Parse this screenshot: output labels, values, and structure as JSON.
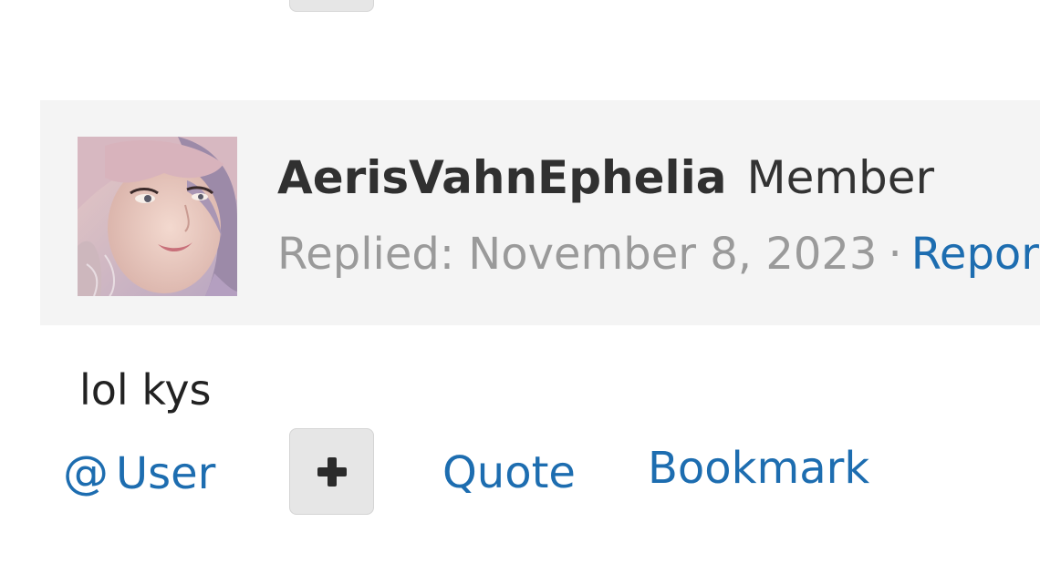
{
  "post": {
    "author": {
      "name": "AerisVahnEphelia",
      "role": "Member"
    },
    "meta": {
      "replied_label": "Replied: November 8, 2023",
      "separator": "·",
      "report_label": "Report"
    },
    "body": "lol kys",
    "actions": {
      "user_at": "@",
      "user_label": "User",
      "more_icon": "plus-icon",
      "quote_label": "Quote",
      "bookmark_label": "Bookmark"
    }
  },
  "colors": {
    "link": "#1d6db0",
    "header_bg": "#f4f4f4",
    "button_bg": "#e6e6e6",
    "meta_text": "#9a9a9a"
  }
}
